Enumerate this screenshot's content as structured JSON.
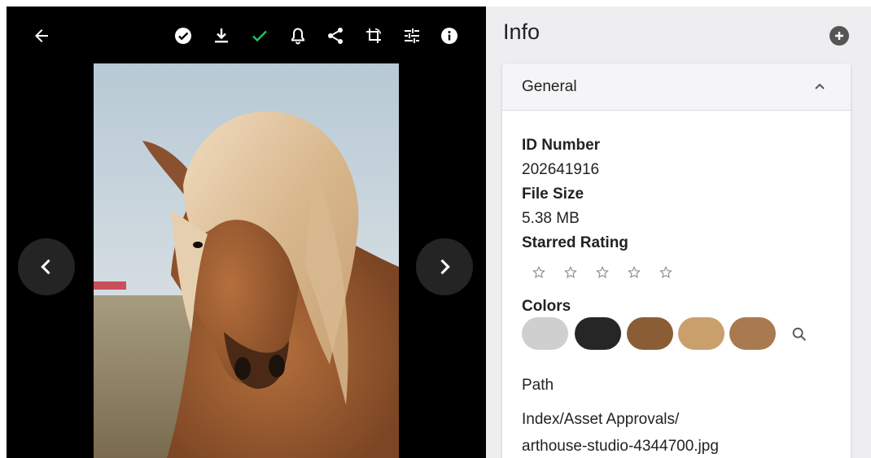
{
  "toolbar": {
    "icons": [
      "back-arrow-icon",
      "approve-circle-icon",
      "download-icon",
      "check-icon",
      "bell-icon",
      "share-icon",
      "crop-rotate-icon",
      "adjust-sliders-icon",
      "info-icon"
    ],
    "check_color": "#22c55e"
  },
  "viewer": {
    "prev_icon": "chevron-left-icon",
    "next_icon": "chevron-right-icon"
  },
  "info": {
    "title": "Info",
    "section_title": "General",
    "id_label": "ID Number",
    "id_value": "202641916",
    "size_label": "File Size",
    "size_value": "5.38 MB",
    "rating_label": "Starred Rating",
    "rating_value": 0,
    "rating_max": 5,
    "colors_label": "Colors",
    "colors": [
      "#cfcfcf",
      "#262626",
      "#8a5d35",
      "#c9a06c",
      "#a97a50"
    ],
    "path_label": "Path",
    "path": {
      "index": "Index",
      "sep": "/",
      "folder": "Asset Approvals",
      "filename": "arthouse-studio-4344700.jpg"
    }
  }
}
